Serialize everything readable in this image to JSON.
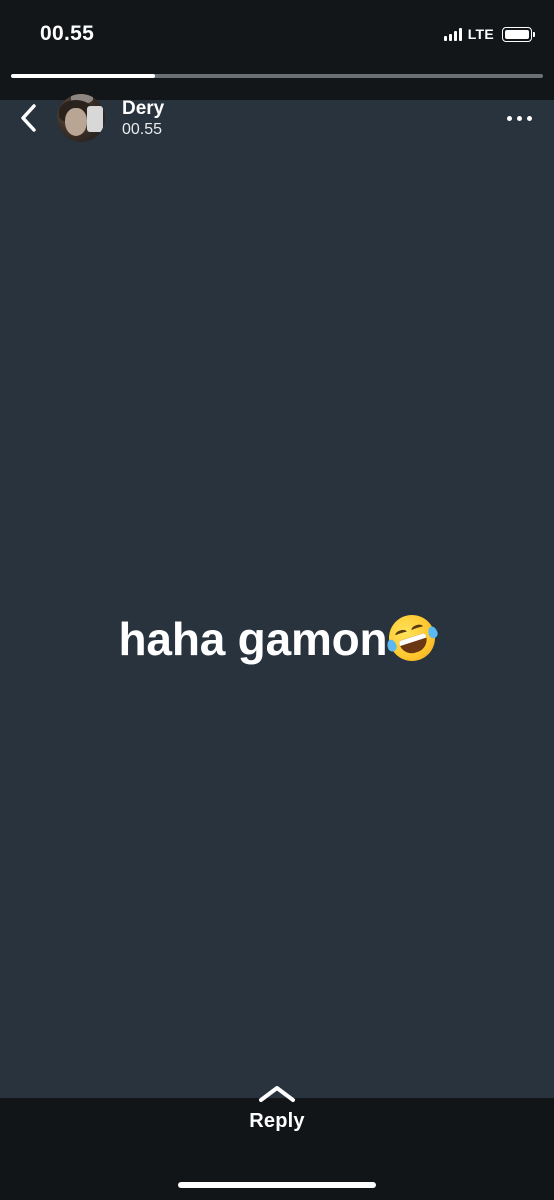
{
  "status_bar": {
    "time": "00.55",
    "network": "LTE",
    "signal_bars": 4,
    "battery_level": 1.0
  },
  "story": {
    "progress": 0.27,
    "contact_name": "Dery",
    "posted_time": "00.55",
    "text": "haha gamon",
    "emoji": "rolling-on-the-floor-laughing",
    "background_color": "#28333e"
  },
  "footer": {
    "reply_label": "Reply"
  },
  "icons": {
    "back": "chevron-left-icon",
    "more": "more-horizontal-icon",
    "reply": "chevron-up-icon"
  }
}
